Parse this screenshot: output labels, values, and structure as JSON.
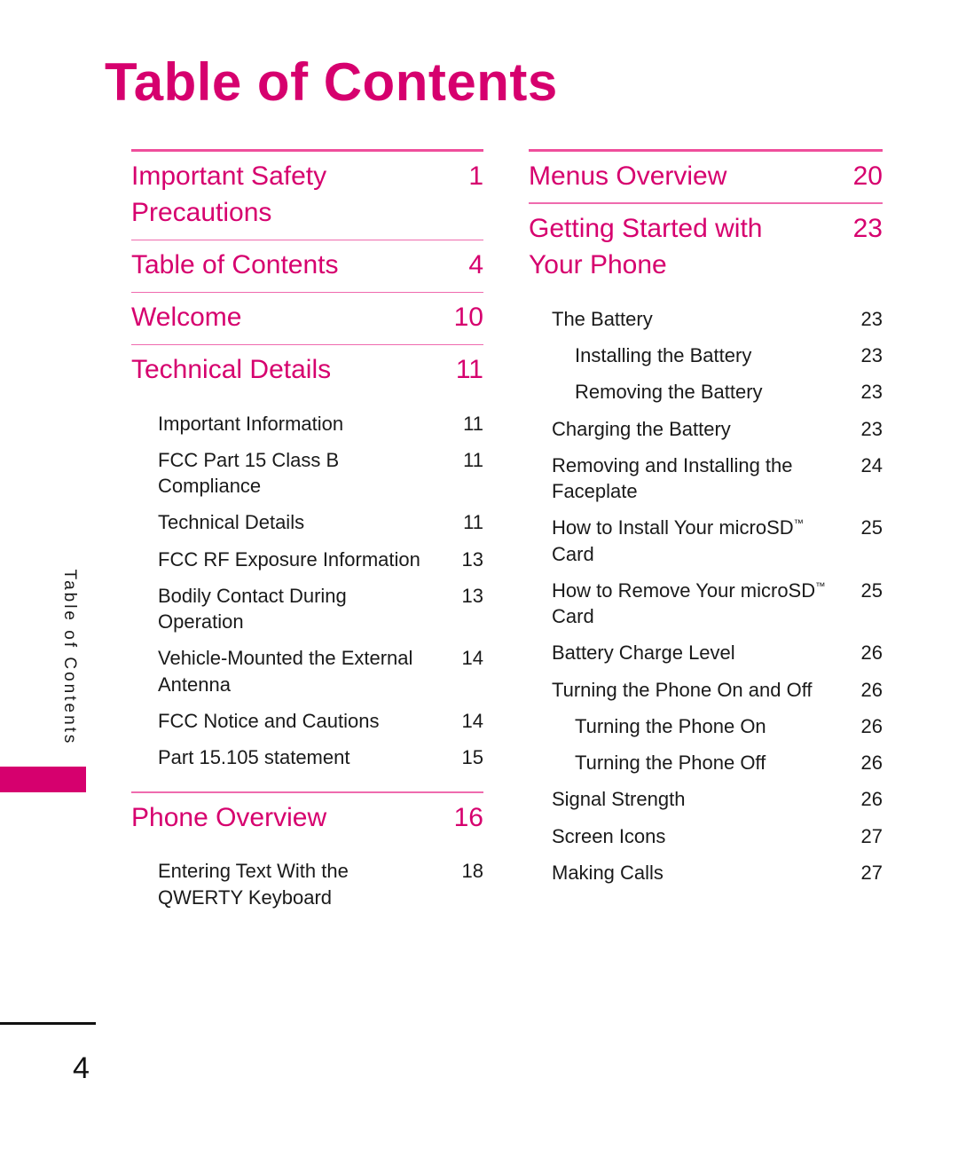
{
  "page_title": "Table of Contents",
  "side_tab": {
    "label": "Table of Contents"
  },
  "footer": {
    "page_number": "4"
  },
  "colors": {
    "accent": "#d6006e",
    "rule_thick": "#ef4e9b",
    "rule_thin": "#ef6bae",
    "body_text": "#1a1a1a"
  },
  "left_column": {
    "entries": [
      {
        "label": "Important Safety Precautions",
        "page": "1",
        "level": "major"
      },
      {
        "label": "Table of Contents",
        "page": "4",
        "level": "major"
      },
      {
        "label": "Welcome",
        "page": "10",
        "level": "major"
      },
      {
        "label": "Technical Details",
        "page": "11",
        "level": "major"
      },
      {
        "label": "Important Information",
        "page": "11",
        "level": "sub1"
      },
      {
        "label": "FCC Part 15 Class B Compliance",
        "page": "11",
        "level": "sub1"
      },
      {
        "label": "Technical Details",
        "page": "11",
        "level": "sub1"
      },
      {
        "label": "FCC RF Exposure Information",
        "page": "13",
        "level": "sub1"
      },
      {
        "label": "Bodily Contact During Operation",
        "page": "13",
        "level": "sub1"
      },
      {
        "label": "Vehicle-Mounted the External Antenna",
        "page": "14",
        "level": "sub1"
      },
      {
        "label": "FCC Notice and Cautions",
        "page": "14",
        "level": "sub1"
      },
      {
        "label": "Part 15.105 statement",
        "page": "15",
        "level": "sub1"
      },
      {
        "label": "Phone Overview",
        "page": "16",
        "level": "major"
      },
      {
        "label": "Entering Text With the QWERTY Keyboard",
        "page": "18",
        "level": "sub1"
      }
    ]
  },
  "right_column": {
    "entries": [
      {
        "label": "Menus Overview",
        "page": "20",
        "level": "major"
      },
      {
        "label": "Getting Started with Your Phone",
        "page": "23",
        "level": "major"
      },
      {
        "label": "The Battery",
        "page": "23",
        "level": "sub1"
      },
      {
        "label": "Installing the Battery",
        "page": "23",
        "level": "sub2"
      },
      {
        "label": "Removing the Battery",
        "page": "23",
        "level": "sub2"
      },
      {
        "label": "Charging the Battery",
        "page": "23",
        "level": "sub1"
      },
      {
        "label": "Removing and Installing the Faceplate",
        "page": "24",
        "level": "sub1"
      },
      {
        "label": "How to Install Your microSD™ Card",
        "page": "25",
        "level": "sub1",
        "trademark": true
      },
      {
        "label": "How to Remove Your microSD™ Card",
        "page": "25",
        "level": "sub1",
        "trademark": true
      },
      {
        "label": "Battery Charge Level",
        "page": "26",
        "level": "sub1"
      },
      {
        "label": "Turning the Phone On and Off",
        "page": "26",
        "level": "sub1"
      },
      {
        "label": "Turning the Phone On",
        "page": "26",
        "level": "sub2"
      },
      {
        "label": "Turning the Phone Off",
        "page": "26",
        "level": "sub2"
      },
      {
        "label": "Signal Strength",
        "page": "26",
        "level": "sub1"
      },
      {
        "label": "Screen Icons",
        "page": "27",
        "level": "sub1"
      },
      {
        "label": "Making Calls",
        "page": "27",
        "level": "sub1"
      }
    ]
  }
}
